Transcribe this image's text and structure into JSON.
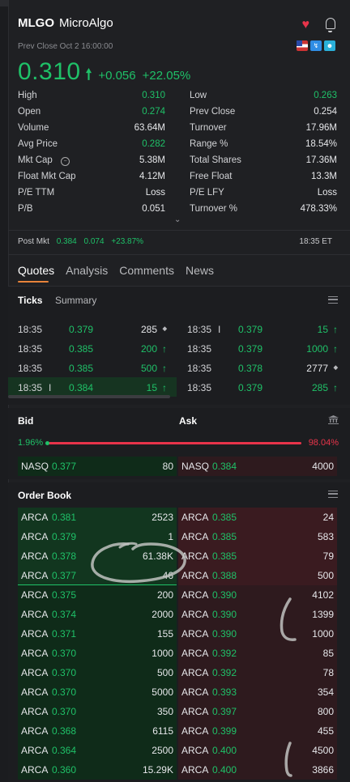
{
  "header": {
    "ticker": "MLGO",
    "company": "MicroAlgo",
    "prev_close_label": "Prev Close Oct 2 16:00:00",
    "price": "0.310",
    "change": "+0.056",
    "change_pct": "+22.05%"
  },
  "stats": [
    {
      "lk": "High",
      "lv": "0.310",
      "lvc": "g",
      "rk": "Low",
      "rv": "0.263",
      "rvc": "g"
    },
    {
      "lk": "Open",
      "lv": "0.274",
      "lvc": "g",
      "rk": "Prev Close",
      "rv": "0.254",
      "rvc": "w"
    },
    {
      "lk": "Volume",
      "lv": "63.64M",
      "lvc": "w",
      "rk": "Turnover",
      "rv": "17.96M",
      "rvc": "w"
    },
    {
      "lk": "Avg Price",
      "lv": "0.282",
      "lvc": "g",
      "rk": "Range %",
      "rv": "18.54%",
      "rvc": "w"
    },
    {
      "lk": "Mkt Cap",
      "lv": "5.38M",
      "lvc": "w",
      "rk": "Total Shares",
      "rv": "17.36M",
      "rvc": "w"
    },
    {
      "lk": "Float Mkt Cap",
      "lv": "4.12M",
      "lvc": "w",
      "rk": "Free Float",
      "rv": "13.3M",
      "rvc": "w"
    },
    {
      "lk": "P/E TTM",
      "lv": "Loss",
      "lvc": "w",
      "rk": "P/E LFY",
      "rv": "Loss",
      "rvc": "w"
    },
    {
      "lk": "P/B",
      "lv": "0.051",
      "lvc": "w",
      "rk": "Turnover %",
      "rv": "478.33%",
      "rvc": "w"
    }
  ],
  "post_market": {
    "label": "Post Mkt",
    "price": "0.384",
    "change": "0.074",
    "change_pct": "+23.87%",
    "time": "18:35 ET"
  },
  "tabs": [
    "Quotes",
    "Analysis",
    "Comments",
    "News"
  ],
  "ticks_section": {
    "title": "Ticks",
    "subtab": "Summary",
    "left": [
      {
        "t": "18:35",
        "p": "0.379",
        "v": "285",
        "dir": "diamond",
        "mark": ""
      },
      {
        "t": "18:35",
        "p": "0.385",
        "v": "200",
        "dir": "up",
        "mark": ""
      },
      {
        "t": "18:35",
        "p": "0.385",
        "v": "500",
        "dir": "up",
        "mark": ""
      },
      {
        "t": "18:35",
        "p": "0.384",
        "v": "15",
        "dir": "up",
        "mark": "I"
      }
    ],
    "right": [
      {
        "t": "18:35",
        "p": "0.379",
        "v": "15",
        "dir": "up",
        "mark": "I"
      },
      {
        "t": "18:35",
        "p": "0.379",
        "v": "1000",
        "dir": "up",
        "mark": ""
      },
      {
        "t": "18:35",
        "p": "0.378",
        "v": "2777",
        "dir": "diamond",
        "mark": ""
      },
      {
        "t": "18:35",
        "p": "0.379",
        "v": "285",
        "dir": "up",
        "mark": ""
      }
    ]
  },
  "bidask": {
    "bid_label": "Bid",
    "ask_label": "Ask",
    "bid_pct": "1.96%",
    "ask_pct": "98.04%",
    "bid_ratio": 0.0196,
    "best_bid": {
      "ex": "NASQ",
      "price": "0.377",
      "size": "80"
    },
    "best_ask": {
      "ex": "NASQ",
      "price": "0.384",
      "size": "4000"
    }
  },
  "order_book": {
    "title": "Order Book",
    "bids": [
      {
        "ex": "ARCA",
        "price": "0.381",
        "size": "2523"
      },
      {
        "ex": "ARCA",
        "price": "0.379",
        "size": "1"
      },
      {
        "ex": "ARCA",
        "price": "0.378",
        "size": "61.38K"
      },
      {
        "ex": "ARCA",
        "price": "0.377",
        "size": "46"
      },
      {
        "ex": "ARCA",
        "price": "0.375",
        "size": "200"
      },
      {
        "ex": "ARCA",
        "price": "0.374",
        "size": "2000"
      },
      {
        "ex": "ARCA",
        "price": "0.371",
        "size": "155"
      },
      {
        "ex": "ARCA",
        "price": "0.370",
        "size": "1000"
      },
      {
        "ex": "ARCA",
        "price": "0.370",
        "size": "500"
      },
      {
        "ex": "ARCA",
        "price": "0.370",
        "size": "5000"
      },
      {
        "ex": "ARCA",
        "price": "0.370",
        "size": "350"
      },
      {
        "ex": "ARCA",
        "price": "0.368",
        "size": "6115"
      },
      {
        "ex": "ARCA",
        "price": "0.364",
        "size": "2500"
      },
      {
        "ex": "ARCA",
        "price": "0.360",
        "size": "15.29K"
      }
    ],
    "asks": [
      {
        "ex": "ARCA",
        "price": "0.385",
        "size": "24"
      },
      {
        "ex": "ARCA",
        "price": "0.385",
        "size": "583"
      },
      {
        "ex": "ARCA",
        "price": "0.385",
        "size": "79"
      },
      {
        "ex": "ARCA",
        "price": "0.388",
        "size": "500"
      },
      {
        "ex": "ARCA",
        "price": "0.390",
        "size": "4102"
      },
      {
        "ex": "ARCA",
        "price": "0.390",
        "size": "1399"
      },
      {
        "ex": "ARCA",
        "price": "0.390",
        "size": "1000"
      },
      {
        "ex": "ARCA",
        "price": "0.392",
        "size": "85"
      },
      {
        "ex": "ARCA",
        "price": "0.392",
        "size": "78"
      },
      {
        "ex": "ARCA",
        "price": "0.393",
        "size": "354"
      },
      {
        "ex": "ARCA",
        "price": "0.397",
        "size": "800"
      },
      {
        "ex": "ARCA",
        "price": "0.399",
        "size": "455"
      },
      {
        "ex": "ARCA",
        "price": "0.400",
        "size": "4500"
      },
      {
        "ex": "ARCA",
        "price": "0.400",
        "size": "3866"
      }
    ]
  },
  "colors": {
    "up": "#1fc168",
    "down": "#e8344a",
    "accent": "#e8833a"
  },
  "icons": [
    "heart-icon",
    "bell-icon",
    "us-flag-icon",
    "p-badge-icon",
    "q-badge-icon",
    "clock-icon",
    "chevron-down-icon",
    "menu-icon",
    "bank-icon"
  ]
}
